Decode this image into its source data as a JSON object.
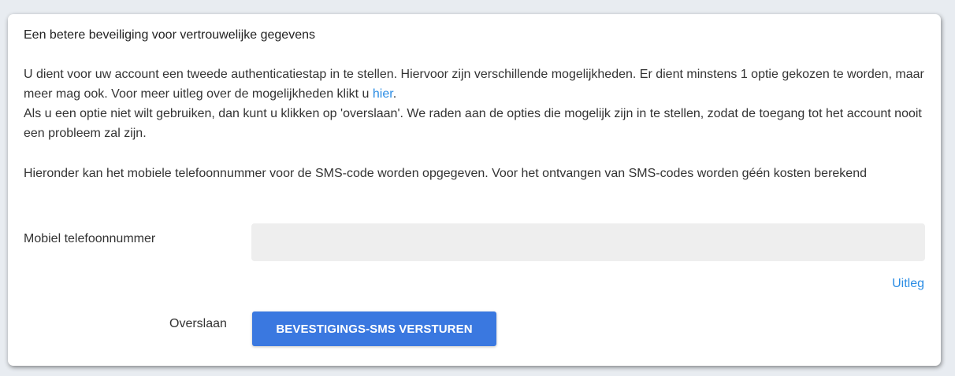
{
  "card": {
    "title": "Een betere beveiliging voor vertrouwelijke gegevens",
    "intro_part1": "U dient voor uw account een tweede authenticatiestap in te stellen. Hiervoor zijn verschillende mogelijkheden. Er dient minstens 1 optie gekozen te worden, maar meer mag ook. Voor meer uitleg over de mogelijkheden klikt u ",
    "intro_link": "hier",
    "intro_part2": ".",
    "intro_line2": "Als u een optie niet wilt gebruiken, dan kunt u klikken op 'overslaan'. We raden aan de opties die mogelijk zijn in te stellen, zodat de toegang tot het account nooit een probleem zal zijn.",
    "sms_info": "Hieronder kan het mobiele telefoonnummer voor de SMS-code worden opgegeven. Voor het ontvangen van SMS-codes worden géén kosten berekend"
  },
  "form": {
    "phone_label": "Mobiel telefoonnummer",
    "phone_value": "",
    "phone_placeholder": "",
    "uitleg_link": "Uitleg",
    "skip_label": "Overslaan",
    "send_button": "BEVESTIGINGS-SMS VERSTUREN"
  },
  "colors": {
    "accent": "#3a78e0",
    "link": "#2a8ce4",
    "background": "#e8ecf1",
    "input_background": "#eeeeee"
  }
}
